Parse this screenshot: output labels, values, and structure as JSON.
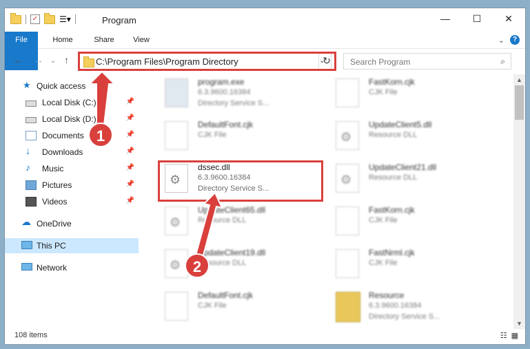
{
  "window": {
    "title": "Program"
  },
  "ribbon": {
    "tabs": [
      "File",
      "Home",
      "Share",
      "View"
    ]
  },
  "address": {
    "path": "C:\\Program Files\\Program Directory"
  },
  "search": {
    "placeholder": "Search Program"
  },
  "sidebar": {
    "items": [
      {
        "label": "Quick access",
        "icon": "star-icon"
      },
      {
        "label": "Local Disk (C:)",
        "icon": "drive-icon"
      },
      {
        "label": "Local Disk (D:)",
        "icon": "drive-icon"
      },
      {
        "label": "Documents",
        "icon": "documents-icon"
      },
      {
        "label": "Downloads",
        "icon": "download-icon"
      },
      {
        "label": "Music",
        "icon": "music-icon"
      },
      {
        "label": "Pictures",
        "icon": "pictures-icon"
      },
      {
        "label": "Videos",
        "icon": "videos-icon"
      },
      {
        "label": "OneDrive",
        "icon": "cloud-icon"
      },
      {
        "label": "This PC",
        "icon": "pc-icon"
      },
      {
        "label": "Network",
        "icon": "network-icon"
      }
    ]
  },
  "files": [
    {
      "name": "program.exe",
      "line1": "6.3.9600.16384",
      "line2": "Directory Service S..."
    },
    {
      "name": "FastKorn.cjk",
      "line1": "CJK File",
      "line2": ""
    },
    {
      "name": "DefaultFont.cjk",
      "line1": "CJK File",
      "line2": ""
    },
    {
      "name": "UpdateClient5.dll",
      "line1": "Resource DLL",
      "line2": ""
    },
    {
      "name": "dssec.dll",
      "line1": "6.3.9600.16384",
      "line2": "Directory Service S..."
    },
    {
      "name": "UpdateClient21.dll",
      "line1": "Resource DLL",
      "line2": ""
    },
    {
      "name": "UpdateClient65.dll",
      "line1": "Resource DLL",
      "line2": ""
    },
    {
      "name": "FastKorn.cjk",
      "line1": "CJK File",
      "line2": ""
    },
    {
      "name": "UpdateClient19.dll",
      "line1": "Resource DLL",
      "line2": ""
    },
    {
      "name": "FastNrml.cjk",
      "line1": "CJK File",
      "line2": ""
    },
    {
      "name": "DefaultFont.cjk",
      "line1": "CJK File",
      "line2": ""
    },
    {
      "name": "Resource",
      "line1": "6.3.9600.16384",
      "line2": "Directory Service S..."
    }
  ],
  "status": {
    "count": "108 items"
  },
  "annotations": {
    "step1": "1",
    "step2": "2"
  },
  "colors": {
    "accent": "#1979ca",
    "highlight": "#d9403c"
  }
}
